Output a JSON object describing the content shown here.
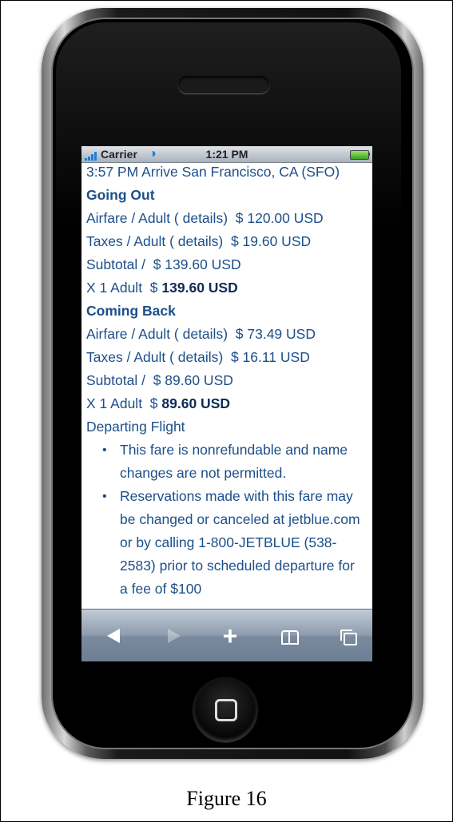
{
  "status": {
    "carrier": "Carrier",
    "time": "1:21 PM"
  },
  "content": {
    "arrival": "3:57 PM Arrive San Francisco, CA (SFO)",
    "going_out": {
      "heading": "Going Out",
      "airfare_label": "Airfare / Adult ( details)",
      "airfare_value": "$ 120.00 USD",
      "taxes_label": "Taxes / Adult ( details)",
      "taxes_value": "$ 19.60 USD",
      "subtotal_label": "Subtotal /",
      "subtotal_value": "$ 139.60 USD",
      "count_label": "X 1 Adult",
      "total_prefix": "$",
      "total_value": "139.60 USD"
    },
    "coming_back": {
      "heading": "Coming Back",
      "airfare_label": "Airfare / Adult ( details)",
      "airfare_value": "$ 73.49 USD",
      "taxes_label": "Taxes / Adult ( details)",
      "taxes_value": "$ 16.11 USD",
      "subtotal_label": "Subtotal /",
      "subtotal_value": "$ 89.60 USD",
      "count_label": "X 1 Adult",
      "total_prefix": "$",
      "total_value": "89.60 USD"
    },
    "departing_heading": "Departing Flight",
    "notes": [
      "This fare is nonrefundable and name changes are not permitted.",
      "Reservations made with this fare may be changed or canceled at jetblue.com or by calling 1-800-JETBLUE (538-2583) prior to scheduled departure for a fee of $100"
    ]
  },
  "toolbar": {
    "back_icon": "back-arrow-icon",
    "forward_icon": "forward-arrow-icon",
    "add_label": "+",
    "bookmarks_icon": "bookmarks-icon",
    "pages_icon": "pages-icon"
  },
  "caption": "Figure 16"
}
